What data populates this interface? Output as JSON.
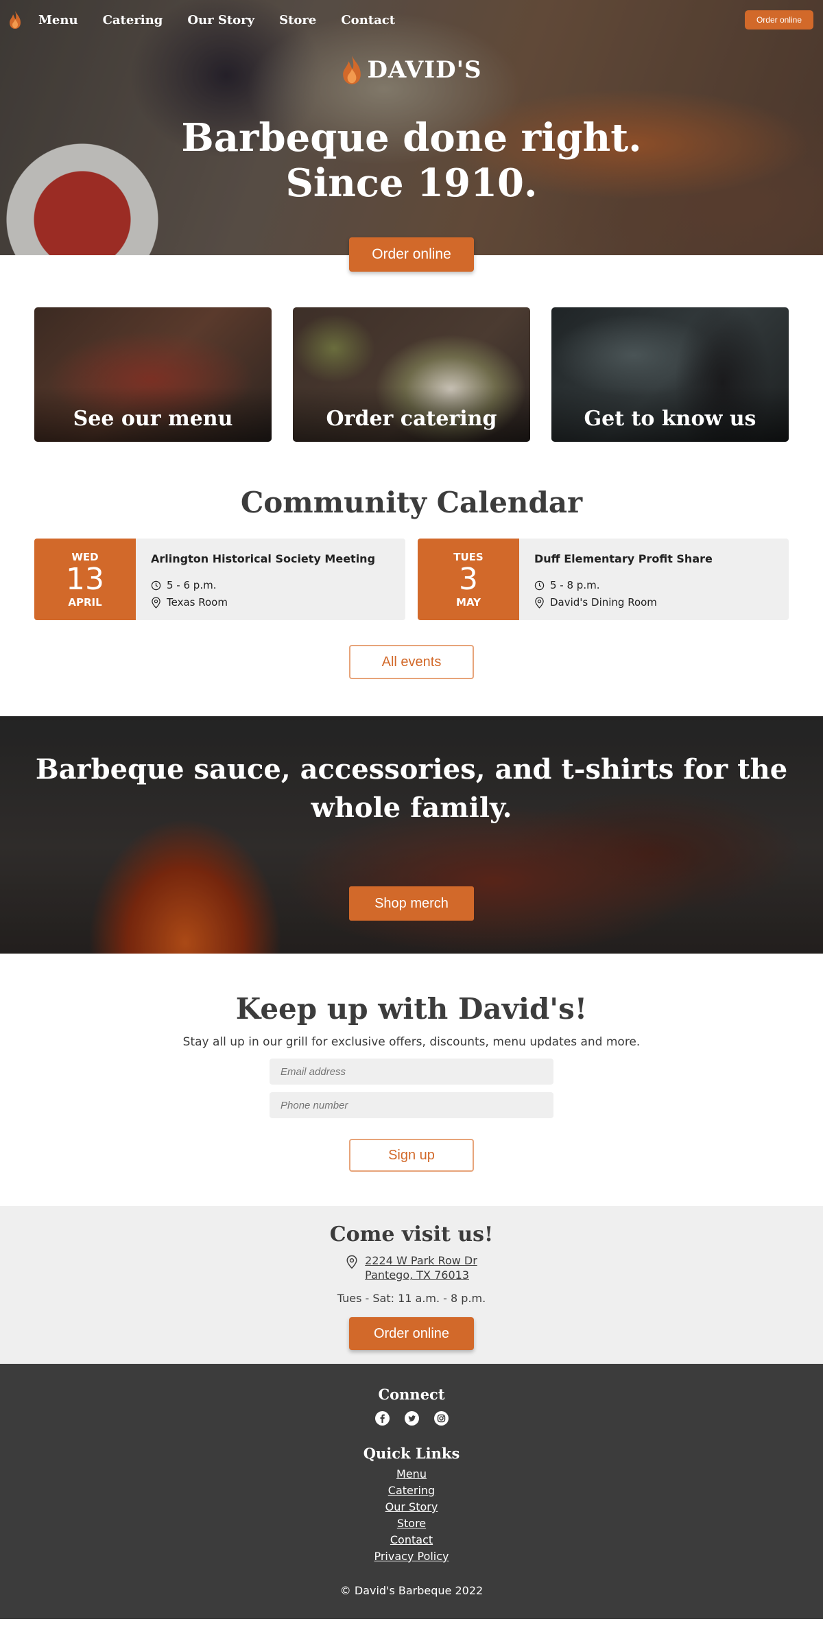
{
  "nav": {
    "links": [
      "Menu",
      "Catering",
      "Our Story",
      "Store",
      "Contact"
    ],
    "order_label": "Order online"
  },
  "brand": {
    "name": "DAVID'S"
  },
  "hero": {
    "title_line1": "Barbeque done right.",
    "title_line2": "Since 1910.",
    "button_label": "Order online"
  },
  "cards": [
    {
      "label": "See our menu"
    },
    {
      "label": "Order catering"
    },
    {
      "label": "Get to know us"
    }
  ],
  "calendar": {
    "title": "Community Calendar",
    "events": [
      {
        "day": "WED",
        "date": "13",
        "month": "APRIL",
        "title": "Arlington Historical Society Meeting",
        "time": "5 - 6 p.m.",
        "location": "Texas Room"
      },
      {
        "day": "TUES",
        "date": "3",
        "month": "MAY",
        "title": "Duff Elementary Profit Share",
        "time": "5 - 8 p.m.",
        "location": "David's Dining Room"
      }
    ],
    "all_events_label": "All events"
  },
  "merch": {
    "title": "Barbeque sauce, accessories, and t-shirts for the whole family.",
    "button_label": "Shop merch"
  },
  "newsletter": {
    "title": "Keep up with David's!",
    "subtitle": "Stay all up in our grill for exclusive offers, discounts, menu updates and more.",
    "email_placeholder": "Email address",
    "phone_placeholder": "Phone number",
    "button_label": "Sign up"
  },
  "visit": {
    "title": "Come visit us!",
    "address_line1": "2224 W Park Row Dr",
    "address_line2": "Pantego, TX 76013",
    "hours": "Tues - Sat: 11 a.m. - 8 p.m.",
    "button_label": "Order online"
  },
  "footer": {
    "connect_title": "Connect",
    "social_icons": [
      "facebook-icon",
      "twitter-icon",
      "instagram-icon"
    ],
    "quick_links_title": "Quick Links",
    "quick_links": [
      "Menu",
      "Catering",
      "Our Story",
      "Store",
      "Contact",
      "Privacy Policy"
    ],
    "copyright": "© David's Barbeque 2022"
  },
  "colors": {
    "accent": "#d2692a",
    "dark": "#3c3c3c",
    "light_gray": "#efefef"
  }
}
